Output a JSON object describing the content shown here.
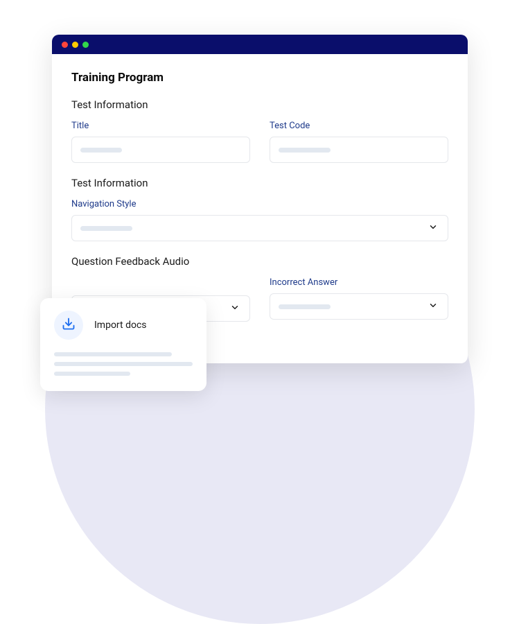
{
  "page_title": "Training Program",
  "sections": {
    "info1": {
      "heading": "Test Information",
      "title_label": "Title",
      "code_label": "Test Code"
    },
    "info2": {
      "heading": "Test Information",
      "nav_label": "Navigation Style"
    },
    "feedback": {
      "heading": "Question Feedback Audio",
      "incorrect_label": "Incorrect Answer"
    }
  },
  "import_card": {
    "title": "Import docs"
  }
}
